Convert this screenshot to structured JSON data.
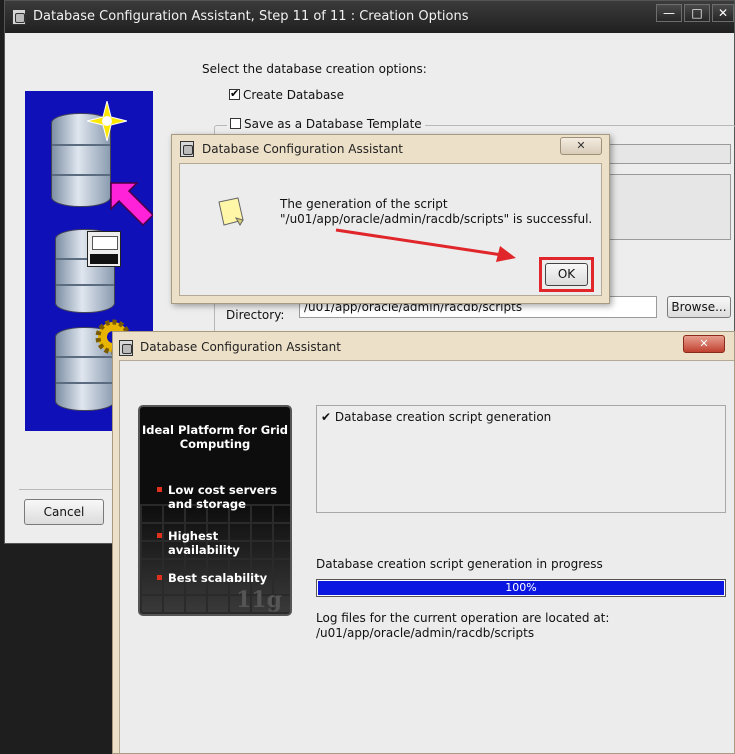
{
  "main_window": {
    "title": "Database Configuration Assistant, Step 11 of 11 : Creation Options",
    "controls": {
      "minimize": "—",
      "maximize": "□",
      "close": "✕"
    },
    "prompt": "Select the database creation options:",
    "create_database_label": "Create Database",
    "create_database_checked": true,
    "save_template_label": "Save as a Database Template",
    "save_template_checked": false,
    "directory_label": "Directory:",
    "directory_value": "/u01/app/oracle/admin/racdb/scripts",
    "browse_label": "Browse...",
    "cancel_label": "Cancel"
  },
  "dialog": {
    "title": "Database Configuration Assistant",
    "close_glyph": "✕",
    "message_line1": "The generation of the script",
    "message_line2": "\"/u01/app/oracle/admin/racdb/scripts\" is successful.",
    "ok_label": "OK",
    "highlight_color": "#e0262a"
  },
  "progress_window": {
    "title": "Database Configuration Assistant",
    "close_glyph": "✕",
    "promo_title": "Ideal Platform for Grid Computing",
    "promo_bullets": [
      "Low cost servers and storage",
      "Highest availability",
      "Best scalability"
    ],
    "promo_logo": "11g",
    "steps": [
      {
        "label": "Database creation script generation",
        "done": true
      }
    ],
    "status_text": "Database creation script generation in progress",
    "progress_percent": 100,
    "progress_label": "100%",
    "log_line1": "Log files for the current operation are located at:",
    "log_line2": "/u01/app/oracle/admin/racdb/scripts"
  }
}
